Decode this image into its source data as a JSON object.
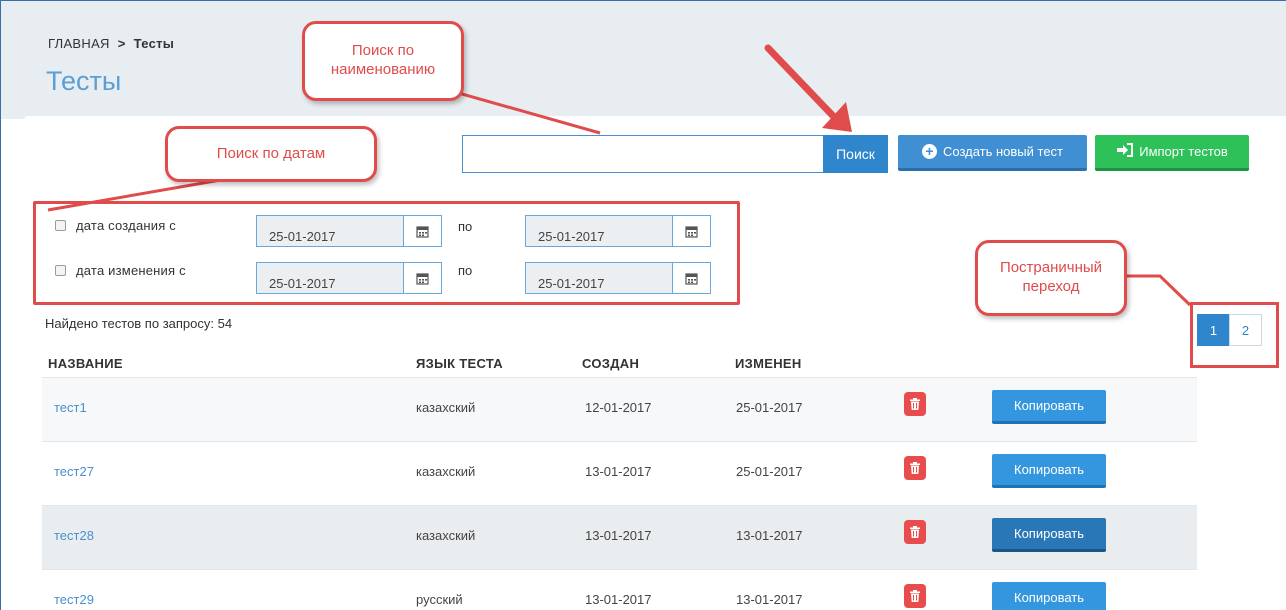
{
  "breadcrumb": {
    "home": "ГЛАВНАЯ",
    "separator": ">",
    "current": "Тесты"
  },
  "page_title": "Тесты",
  "search": {
    "value": "",
    "placeholder": "",
    "button_label": "Поиск"
  },
  "toolbar": {
    "create_label": "Создать новый тест",
    "import_label": "Импорт тестов"
  },
  "date_filter": {
    "created": {
      "label": "дата создания   с",
      "from": "25-01-2017",
      "to_label": "по",
      "to": "25-01-2017",
      "checked": false
    },
    "changed": {
      "label": "дата изменения   с",
      "from": "25-01-2017",
      "to_label": "по",
      "to": "25-01-2017",
      "checked": false
    }
  },
  "found_text": "Найдено тестов по запросу: 54",
  "pagination": {
    "pages": [
      "1",
      "2"
    ],
    "current": "1"
  },
  "table": {
    "columns": [
      "НАЗВАНИЕ",
      "ЯЗЫК ТЕСТА",
      "СОЗДАН",
      "ИЗМЕНЕН"
    ],
    "copy_label": "Копировать",
    "rows": [
      {
        "name": "тест1",
        "language": "казахский",
        "created": "12-01-2017",
        "changed": "25-01-2017"
      },
      {
        "name": "тест27",
        "language": "казахский",
        "created": "13-01-2017",
        "changed": "25-01-2017"
      },
      {
        "name": "тест28",
        "language": "казахский",
        "created": "13-01-2017",
        "changed": "13-01-2017"
      },
      {
        "name": "тест29",
        "language": "русский",
        "created": "13-01-2017",
        "changed": "13-01-2017"
      }
    ]
  },
  "callouts": {
    "search_name": "Поиск по\nнаименованию",
    "search_dates": "Поиск по датам",
    "pagination": "Постраничный\nпереход"
  },
  "colors": {
    "accent": "#2f86cc",
    "success": "#2ec15a",
    "danger": "#e84c4c",
    "annotation": "#e04b4b",
    "title": "#5aa0d6",
    "header_bg": "#e8edf1"
  },
  "icons": {
    "create": "plus-circle-icon",
    "import": "sign-in-icon",
    "calendar": "calendar-icon",
    "delete": "trash-icon"
  }
}
